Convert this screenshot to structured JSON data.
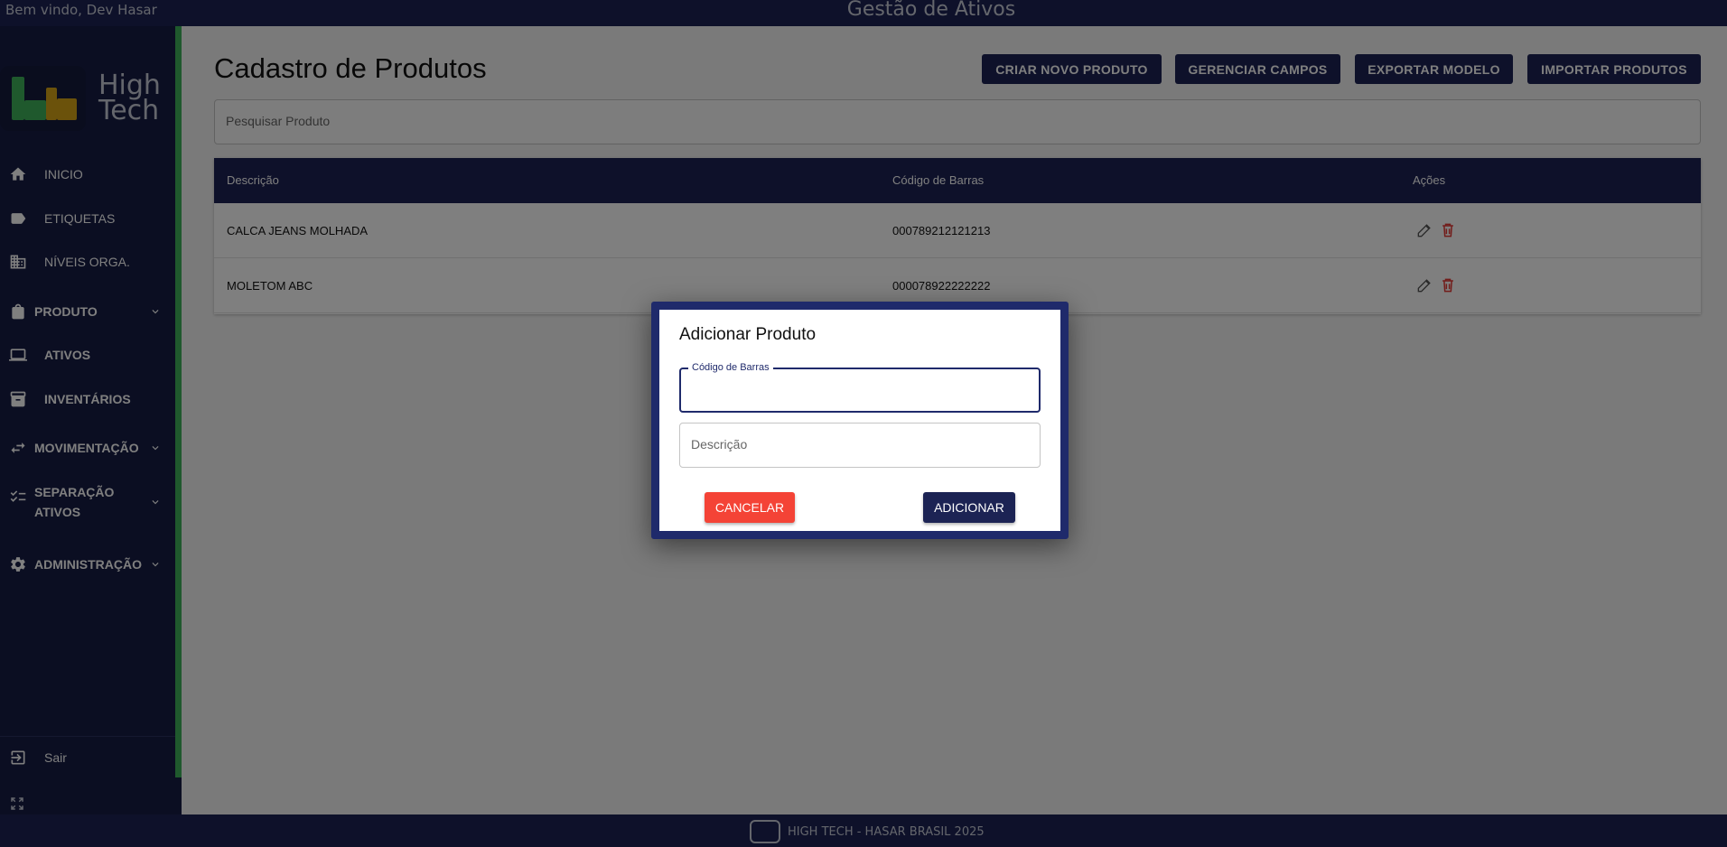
{
  "header": {
    "welcome": "Bem vindo, Dev Hasar",
    "app_title": "Gestão de Ativos"
  },
  "logo": {
    "text_line1": "High",
    "text_line2": "Tech"
  },
  "sidebar": {
    "items": [
      {
        "label": "INICIO",
        "icon": "home-icon"
      },
      {
        "label": "ETIQUETAS",
        "icon": "tag-icon"
      },
      {
        "label": "NÍVEIS ORGA.",
        "icon": "building-icon"
      },
      {
        "label": "PRODUTO",
        "icon": "shopping-bag-icon"
      },
      {
        "label": "ATIVOS",
        "icon": "laptop-icon"
      },
      {
        "label": "INVENTÁRIOS",
        "icon": "archive-icon"
      },
      {
        "label": "MOVIMENTAÇÃO",
        "icon": "swap-icon"
      },
      {
        "label": "SEPARAÇÃO",
        "label2": "ATIVOS",
        "icon": "checklist-icon"
      },
      {
        "label": "ADMINISTRAÇÃO",
        "icon": "gear-icon"
      }
    ],
    "logout": "Sair"
  },
  "page": {
    "title": "Cadastro de Produtos",
    "buttons": {
      "create": "CRIAR NOVO PRODUTO",
      "manage_fields": "GERENCIAR CAMPOS",
      "export": "EXPORTAR MODELO",
      "import": "IMPORTAR PRODUTOS"
    },
    "search_placeholder": "Pesquisar Produto"
  },
  "table": {
    "headers": [
      "Descrição",
      "Código de Barras",
      "Ações"
    ],
    "rows": [
      {
        "description": "CALCA JEANS MOLHADA",
        "barcode": "000789212121213"
      },
      {
        "description": "MOLETOM ABC",
        "barcode": "000078922222222"
      }
    ]
  },
  "dialog": {
    "title": "Adicionar Produto",
    "barcode_label": "Código de Barras",
    "barcode_value": "",
    "description_placeholder": "Descrição",
    "cancel": "CANCELAR",
    "add": "ADICIONAR"
  },
  "footer": {
    "text": "HIGH TECH - HASAR BRASIL 2025"
  },
  "colors": {
    "navy": "#1c2354",
    "sidebar": "#161c45",
    "accent_green": "#3fb35a",
    "danger": "#f44336"
  }
}
